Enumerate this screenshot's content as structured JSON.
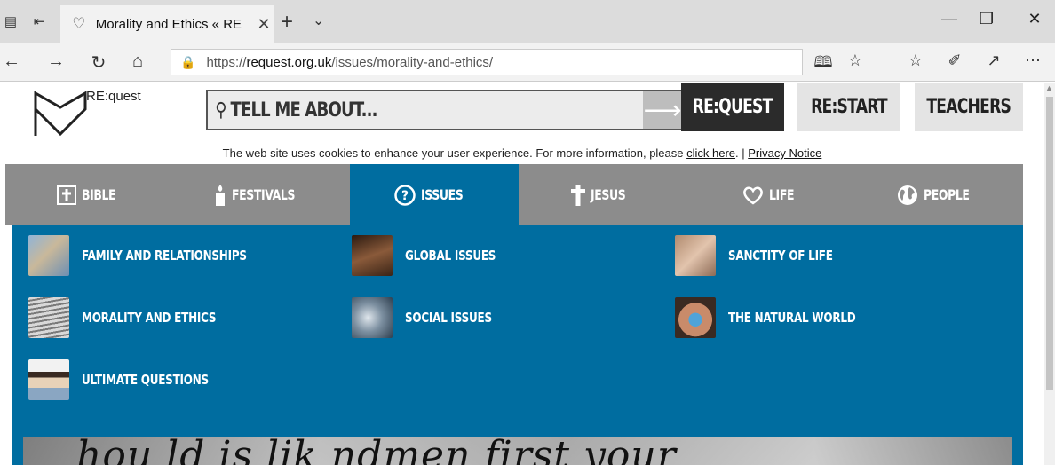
{
  "browser": {
    "tab_title": "Morality and Ethics « RE",
    "url_prefix": "https://",
    "url_domain": "request.org.uk",
    "url_path": "/issues/morality-and-ethics/"
  },
  "site": {
    "logo_text": "RE:quest",
    "search_placeholder": "TELL ME ABOUT...",
    "top_buttons": {
      "request": "RE:QUEST",
      "restart": "RE:START",
      "teachers": "TEACHERS"
    },
    "cookie": {
      "text": "The web site uses cookies to enhance your user experience. For more information, please ",
      "link1": "click here",
      "sep": ". | ",
      "link2": "Privacy Notice"
    },
    "nav": [
      {
        "label": "BIBLE"
      },
      {
        "label": "FESTIVALS"
      },
      {
        "label": "ISSUES"
      },
      {
        "label": "JESUS"
      },
      {
        "label": "LIFE"
      },
      {
        "label": "PEOPLE"
      }
    ],
    "issues": [
      {
        "label": "FAMILY AND RELATIONSHIPS"
      },
      {
        "label": "GLOBAL ISSUES"
      },
      {
        "label": "SANCTITY OF LIFE"
      },
      {
        "label": "MORALITY AND ETHICS"
      },
      {
        "label": "SOCIAL ISSUES"
      },
      {
        "label": "THE NATURAL WORLD"
      },
      {
        "label": "ULTIMATE QUESTIONS"
      }
    ],
    "hero_text": "hou  ld is lik  ndmen  first  your"
  },
  "colors": {
    "issues_blue": "#006da0",
    "nav_grey": "#8c8c8c",
    "request_dark": "#2b2b2b"
  }
}
